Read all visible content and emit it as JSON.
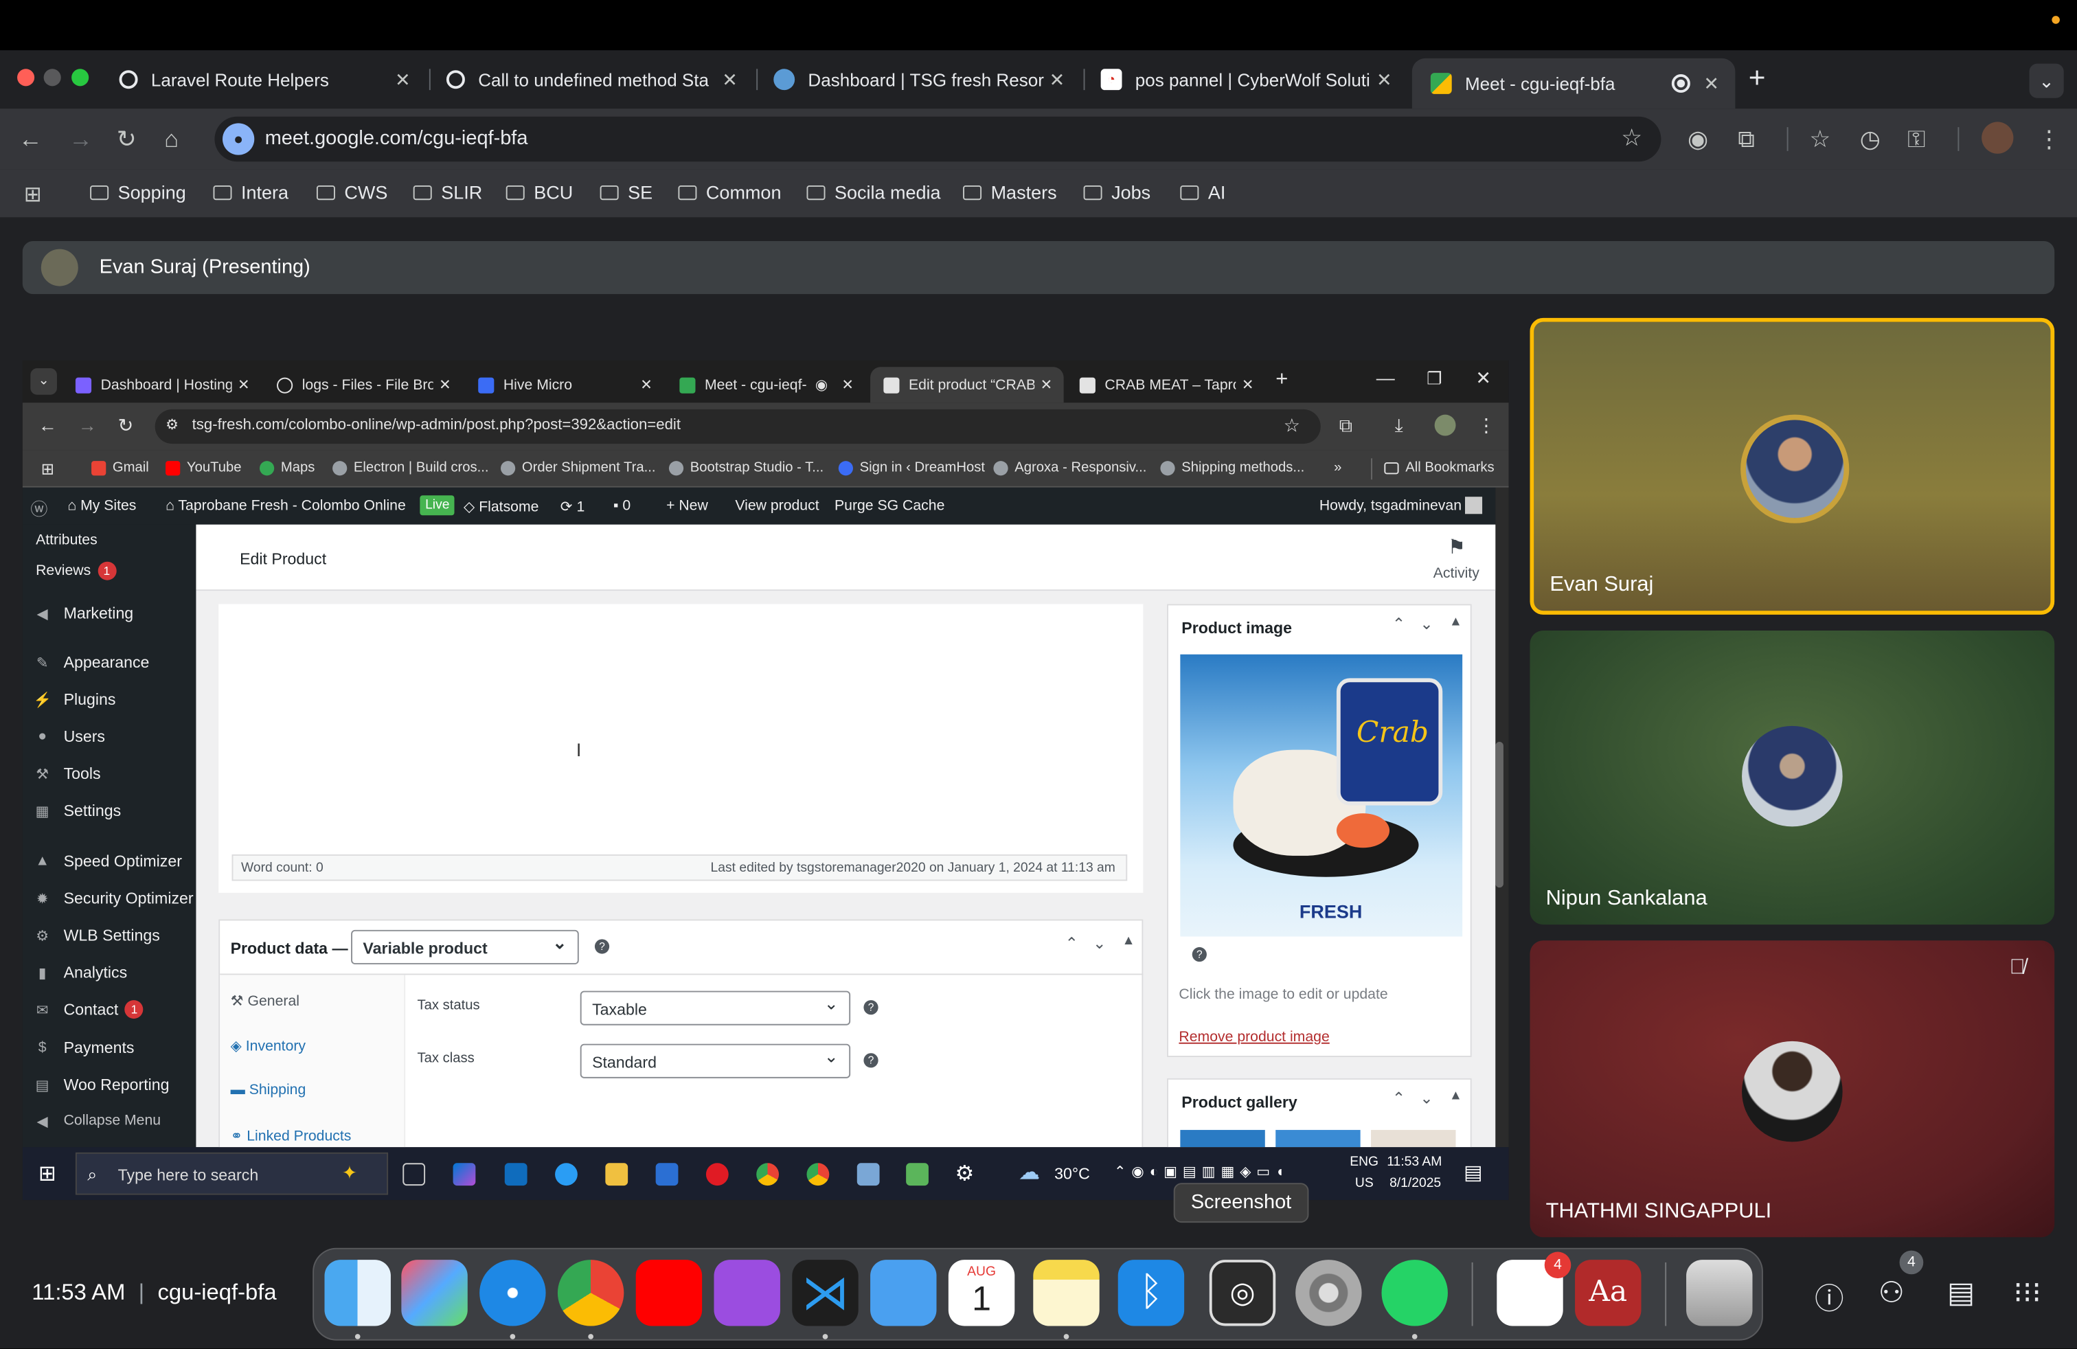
{
  "browser": {
    "tabs": [
      {
        "title": "Laravel Route Helpers"
      },
      {
        "title": "Call to undefined method Sta"
      },
      {
        "title": "Dashboard | TSG fresh Resor"
      },
      {
        "title": "pos pannel | CyberWolf Soluti"
      },
      {
        "title": "Meet - cgu-ieqf-bfa",
        "active": true
      }
    ],
    "url": "meet.google.com/cgu-ieqf-bfa",
    "bookmarks": [
      "Sopping",
      "Intera",
      "CWS",
      "SLIR",
      "BCU",
      "SE",
      "Common",
      "Socila media",
      "Masters",
      "Jobs",
      "AI"
    ]
  },
  "meet": {
    "presenting_label": "Evan Suraj (Presenting)",
    "participants": [
      {
        "name": "Evan Suraj",
        "active": true
      },
      {
        "name": "Nipun Sankalana"
      },
      {
        "name": "THATHMI SINGAPPULI",
        "muted": true
      }
    ],
    "people_count": "4",
    "meeting_code": "cgu-ieqf-bfa",
    "time": "11:53 AM"
  },
  "shared": {
    "tabs": [
      "Dashboard | Hosting",
      "logs - Files - File Brow",
      "Hive Micro",
      "Meet - cgu-ieqf-",
      "Edit product “CRAB M",
      "CRAB MEAT – Taprob"
    ],
    "url": "tsg-fresh.com/colombo-online/wp-admin/post.php?post=392&action=edit",
    "bookmarks": [
      "Gmail",
      "YouTube",
      "Maps",
      "Electron | Build cros...",
      "Order Shipment Tra...",
      "Bootstrap Studio - T...",
      "Sign in ‹ DreamHost",
      "Agroxa - Responsiv...",
      "Shipping methods..."
    ],
    "all_bookmarks": "All Bookmarks",
    "wp_admin_bar": {
      "my_sites": "My Sites",
      "site_name": "Taprobane Fresh - Colombo Online",
      "live": "Live",
      "theme": "Flatsome",
      "updates": "1",
      "comments": "0",
      "new": "New",
      "view_product": "View product",
      "purge": "Purge SG Cache",
      "howdy": "Howdy, tsgadminevan"
    },
    "sidebar": [
      {
        "label": "Attributes"
      },
      {
        "label": "Reviews",
        "badge": "1"
      },
      {
        "label": "Marketing"
      },
      {
        "label": "Appearance"
      },
      {
        "label": "Plugins"
      },
      {
        "label": "Users"
      },
      {
        "label": "Tools"
      },
      {
        "label": "Settings"
      },
      {
        "label": "Speed Optimizer"
      },
      {
        "label": "Security Optimizer"
      },
      {
        "label": "WLB Settings"
      },
      {
        "label": "Analytics"
      },
      {
        "label": "Contact",
        "badge": "1"
      },
      {
        "label": "Payments"
      },
      {
        "label": "Woo Reporting"
      },
      {
        "label": "Collapse Menu"
      }
    ],
    "page_title": "Edit Product",
    "activity": "Activity",
    "word_count": "Word count: 0",
    "last_edited": "Last edited by tsgstoremanager2020 on January 1, 2024 at 11:13 am",
    "product_data_label": "Product data —",
    "product_type": "Variable product",
    "product_tabs": [
      "General",
      "Inventory",
      "Shipping",
      "Linked Products"
    ],
    "tax_status_label": "Tax status",
    "tax_status": "Taxable",
    "tax_class_label": "Tax class",
    "tax_class": "Standard",
    "product_image_title": "Product image",
    "product_image_caption": "Crab",
    "product_image_brand": "FRESH",
    "image_hint": "Click the image to edit or update",
    "remove_image": "Remove product image",
    "gallery_title": "Product gallery"
  },
  "windows_taskbar": {
    "search_placeholder": "Type here to search",
    "weather": "30°C",
    "lang": "ENG",
    "region": "US",
    "time": "11:53 AM",
    "date": "8/1/2025"
  },
  "tooltip": "Screenshot",
  "dock": {
    "calendar_month": "AUG",
    "calendar_day": "1",
    "reminders_badge": "4"
  },
  "colors": {
    "chrome_bg": "#202124",
    "meet_active": "#fbbc04",
    "wp_admin": "#1d2327",
    "link_red": "#b32d2e"
  }
}
